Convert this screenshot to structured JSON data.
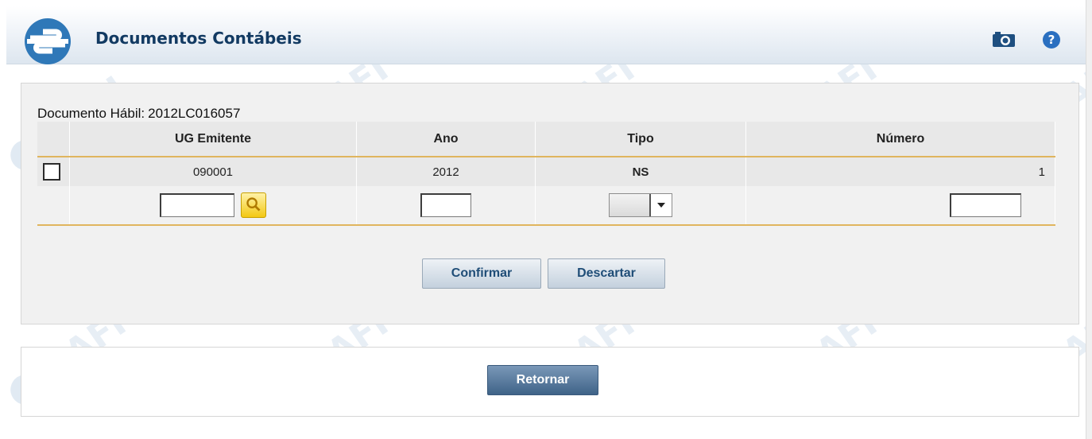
{
  "header": {
    "title": "Documentos Contábeis",
    "icons": [
      "siafi-logo-icon",
      "camera-icon",
      "help-icon"
    ],
    "accent_color": "#123a62"
  },
  "document": {
    "label": "Documento Hábil:",
    "value": "2012LC016057"
  },
  "table": {
    "columns": [
      "UG Emitente",
      "Ano",
      "Tipo",
      "Número"
    ],
    "rows": [
      {
        "ug": "090001",
        "ano": "2012",
        "tipo": "NS",
        "numero": "1",
        "checked": false
      }
    ],
    "new_row": {
      "ug": "",
      "ano": "",
      "tipo": "",
      "numero": ""
    }
  },
  "buttons": {
    "confirm": "Confirmar",
    "discard": "Descartar",
    "return": "Retornar"
  },
  "watermark": {
    "text": "SIAFI"
  },
  "colors": {
    "row_separator": "#e0b55e",
    "return_button": "#4b6d91"
  }
}
